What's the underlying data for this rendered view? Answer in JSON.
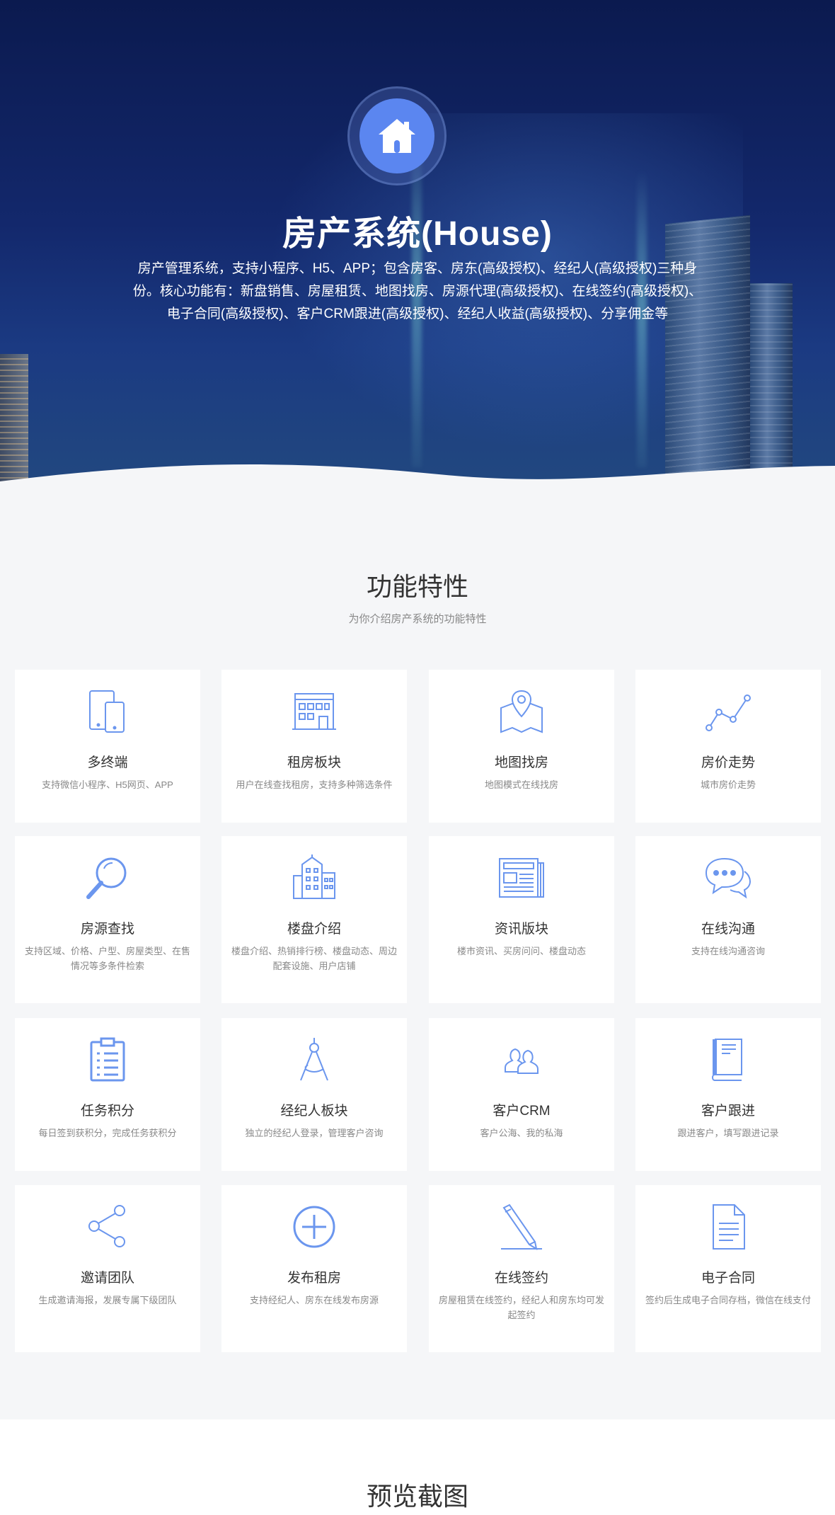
{
  "hero": {
    "title": "房产系统(House)",
    "description": "房产管理系统，支持小程序、H5、APP；包含房客、房东(高级授权)、经纪人(高级授权)三种身份。核心功能有：新盘销售、房屋租赁、地图找房、房源代理(高级授权)、在线签约(高级授权)、电子合同(高级授权)、客户CRM跟进(高级授权)、经纪人收益(高级授权)、分享佣金等",
    "logo_icon": "house-icon"
  },
  "features": {
    "title": "功能特性",
    "subtitle": "为你介绍房产系统的功能特性",
    "icon_color": "#6b96ee",
    "items": [
      {
        "name": "多终端",
        "desc": "支持微信小程序、H5网页、APP",
        "icon": "devices-icon"
      },
      {
        "name": "租房板块",
        "desc": "用户在线查找租房，支持多种筛选条件",
        "icon": "building-icon"
      },
      {
        "name": "地图找房",
        "desc": "地图模式在线找房",
        "icon": "map-pin-icon"
      },
      {
        "name": "房价走势",
        "desc": "城市房价走势",
        "icon": "trend-line-icon"
      },
      {
        "name": "房源查找",
        "desc": "支持区域、价格、户型、房屋类型、在售情况等多条件检索",
        "icon": "search-icon"
      },
      {
        "name": "楼盘介绍",
        "desc": "楼盘介绍、热销排行榜、楼盘动态、周边配套设施、用户店铺",
        "icon": "buildings-icon"
      },
      {
        "name": "资讯版块",
        "desc": "楼市资讯、买房问问、楼盘动态",
        "icon": "newspaper-icon"
      },
      {
        "name": "在线沟通",
        "desc": "支持在线沟通咨询",
        "icon": "chat-bubbles-icon"
      },
      {
        "name": "任务积分",
        "desc": "每日签到获积分，完成任务获积分",
        "icon": "clipboard-icon"
      },
      {
        "name": "经纪人板块",
        "desc": "独立的经纪人登录，管理客户咨询",
        "icon": "compass-icon"
      },
      {
        "name": "客户CRM",
        "desc": "客户公海、我的私海",
        "icon": "users-icon"
      },
      {
        "name": "客户跟进",
        "desc": "跟进客户，填写跟进记录",
        "icon": "notebook-icon"
      },
      {
        "name": "邀请团队",
        "desc": "生成邀请海报，发展专属下级团队",
        "icon": "share-icon"
      },
      {
        "name": "发布租房",
        "desc": "支持经纪人、房东在线发布房源",
        "icon": "plus-circle-icon"
      },
      {
        "name": "在线签约",
        "desc": "房屋租赁在线签约，经纪人和房东均可发起签约",
        "icon": "pencil-icon"
      },
      {
        "name": "电子合同",
        "desc": "签约后生成电子合同存档，微信在线支付",
        "icon": "document-icon"
      }
    ]
  },
  "preview": {
    "title": "预览截图"
  }
}
